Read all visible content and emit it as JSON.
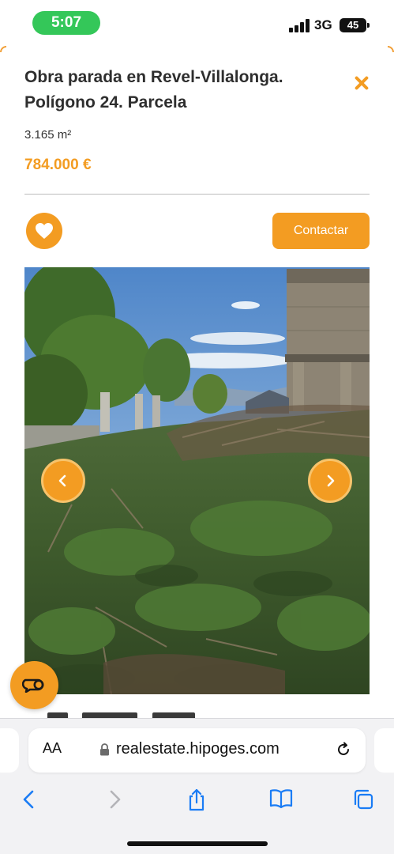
{
  "status_bar": {
    "time": "5:07",
    "network": "3G",
    "battery": "45"
  },
  "listing": {
    "title": "Obra parada en Revel-Villalonga. Polígono 24. Parcela",
    "area": "3.165 m²",
    "price": "784.000 €",
    "contact_label": "Contactar",
    "photo_description_icon": "camera-icon"
  },
  "browser": {
    "aa_label": "AA",
    "url": "realestate.hipoges.com"
  },
  "colors": {
    "accent": "#f39c22",
    "status_green": "#34c759",
    "ios_blue": "#1a7cf5"
  }
}
